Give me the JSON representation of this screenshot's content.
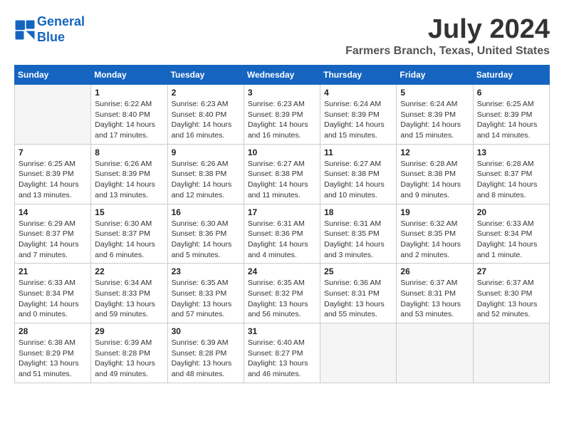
{
  "header": {
    "logo_line1": "General",
    "logo_line2": "Blue",
    "month_year": "July 2024",
    "location": "Farmers Branch, Texas, United States"
  },
  "columns": [
    "Sunday",
    "Monday",
    "Tuesday",
    "Wednesday",
    "Thursday",
    "Friday",
    "Saturday"
  ],
  "weeks": [
    [
      {
        "num": "",
        "info": ""
      },
      {
        "num": "1",
        "info": "Sunrise: 6:22 AM\nSunset: 8:40 PM\nDaylight: 14 hours\nand 17 minutes."
      },
      {
        "num": "2",
        "info": "Sunrise: 6:23 AM\nSunset: 8:40 PM\nDaylight: 14 hours\nand 16 minutes."
      },
      {
        "num": "3",
        "info": "Sunrise: 6:23 AM\nSunset: 8:39 PM\nDaylight: 14 hours\nand 16 minutes."
      },
      {
        "num": "4",
        "info": "Sunrise: 6:24 AM\nSunset: 8:39 PM\nDaylight: 14 hours\nand 15 minutes."
      },
      {
        "num": "5",
        "info": "Sunrise: 6:24 AM\nSunset: 8:39 PM\nDaylight: 14 hours\nand 15 minutes."
      },
      {
        "num": "6",
        "info": "Sunrise: 6:25 AM\nSunset: 8:39 PM\nDaylight: 14 hours\nand 14 minutes."
      }
    ],
    [
      {
        "num": "7",
        "info": "Sunrise: 6:25 AM\nSunset: 8:39 PM\nDaylight: 14 hours\nand 13 minutes."
      },
      {
        "num": "8",
        "info": "Sunrise: 6:26 AM\nSunset: 8:39 PM\nDaylight: 14 hours\nand 13 minutes."
      },
      {
        "num": "9",
        "info": "Sunrise: 6:26 AM\nSunset: 8:38 PM\nDaylight: 14 hours\nand 12 minutes."
      },
      {
        "num": "10",
        "info": "Sunrise: 6:27 AM\nSunset: 8:38 PM\nDaylight: 14 hours\nand 11 minutes."
      },
      {
        "num": "11",
        "info": "Sunrise: 6:27 AM\nSunset: 8:38 PM\nDaylight: 14 hours\nand 10 minutes."
      },
      {
        "num": "12",
        "info": "Sunrise: 6:28 AM\nSunset: 8:38 PM\nDaylight: 14 hours\nand 9 minutes."
      },
      {
        "num": "13",
        "info": "Sunrise: 6:28 AM\nSunset: 8:37 PM\nDaylight: 14 hours\nand 8 minutes."
      }
    ],
    [
      {
        "num": "14",
        "info": "Sunrise: 6:29 AM\nSunset: 8:37 PM\nDaylight: 14 hours\nand 7 minutes."
      },
      {
        "num": "15",
        "info": "Sunrise: 6:30 AM\nSunset: 8:37 PM\nDaylight: 14 hours\nand 6 minutes."
      },
      {
        "num": "16",
        "info": "Sunrise: 6:30 AM\nSunset: 8:36 PM\nDaylight: 14 hours\nand 5 minutes."
      },
      {
        "num": "17",
        "info": "Sunrise: 6:31 AM\nSunset: 8:36 PM\nDaylight: 14 hours\nand 4 minutes."
      },
      {
        "num": "18",
        "info": "Sunrise: 6:31 AM\nSunset: 8:35 PM\nDaylight: 14 hours\nand 3 minutes."
      },
      {
        "num": "19",
        "info": "Sunrise: 6:32 AM\nSunset: 8:35 PM\nDaylight: 14 hours\nand 2 minutes."
      },
      {
        "num": "20",
        "info": "Sunrise: 6:33 AM\nSunset: 8:34 PM\nDaylight: 14 hours\nand 1 minute."
      }
    ],
    [
      {
        "num": "21",
        "info": "Sunrise: 6:33 AM\nSunset: 8:34 PM\nDaylight: 14 hours\nand 0 minutes."
      },
      {
        "num": "22",
        "info": "Sunrise: 6:34 AM\nSunset: 8:33 PM\nDaylight: 13 hours\nand 59 minutes."
      },
      {
        "num": "23",
        "info": "Sunrise: 6:35 AM\nSunset: 8:33 PM\nDaylight: 13 hours\nand 57 minutes."
      },
      {
        "num": "24",
        "info": "Sunrise: 6:35 AM\nSunset: 8:32 PM\nDaylight: 13 hours\nand 56 minutes."
      },
      {
        "num": "25",
        "info": "Sunrise: 6:36 AM\nSunset: 8:31 PM\nDaylight: 13 hours\nand 55 minutes."
      },
      {
        "num": "26",
        "info": "Sunrise: 6:37 AM\nSunset: 8:31 PM\nDaylight: 13 hours\nand 53 minutes."
      },
      {
        "num": "27",
        "info": "Sunrise: 6:37 AM\nSunset: 8:30 PM\nDaylight: 13 hours\nand 52 minutes."
      }
    ],
    [
      {
        "num": "28",
        "info": "Sunrise: 6:38 AM\nSunset: 8:29 PM\nDaylight: 13 hours\nand 51 minutes."
      },
      {
        "num": "29",
        "info": "Sunrise: 6:39 AM\nSunset: 8:28 PM\nDaylight: 13 hours\nand 49 minutes."
      },
      {
        "num": "30",
        "info": "Sunrise: 6:39 AM\nSunset: 8:28 PM\nDaylight: 13 hours\nand 48 minutes."
      },
      {
        "num": "31",
        "info": "Sunrise: 6:40 AM\nSunset: 8:27 PM\nDaylight: 13 hours\nand 46 minutes."
      },
      {
        "num": "",
        "info": ""
      },
      {
        "num": "",
        "info": ""
      },
      {
        "num": "",
        "info": ""
      }
    ]
  ]
}
